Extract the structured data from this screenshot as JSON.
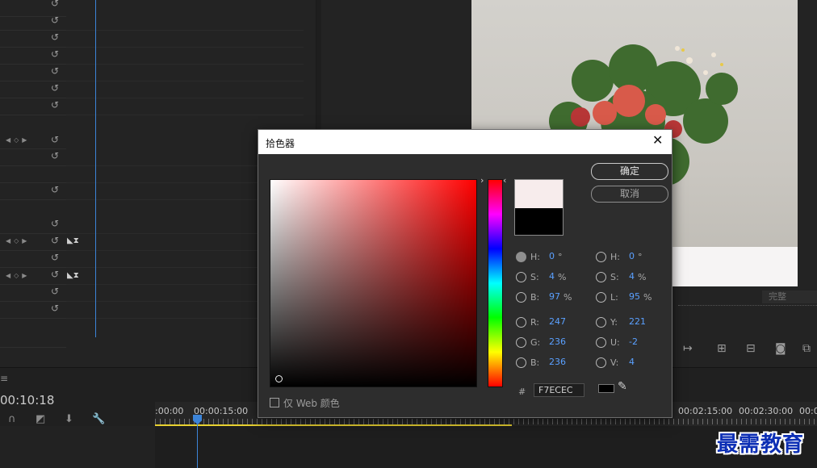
{
  "dialog": {
    "title": "拾色器",
    "ok_label": "确定",
    "cancel_label": "取消",
    "web_only_label": "仅 Web 颜色",
    "hex_label": "#",
    "hex_value": "F7ECEC",
    "new_color": "#F7ECEC",
    "old_color": "#000000",
    "fields_left": [
      {
        "label": "H:",
        "value": "0",
        "unit": "°",
        "selected": true
      },
      {
        "label": "S:",
        "value": "4",
        "unit": "%",
        "selected": false
      },
      {
        "label": "B:",
        "value": "97",
        "unit": "%",
        "selected": false
      },
      {
        "label": "R:",
        "value": "247",
        "unit": "",
        "selected": false
      },
      {
        "label": "G:",
        "value": "236",
        "unit": "",
        "selected": false
      },
      {
        "label": "B:",
        "value": "236",
        "unit": "",
        "selected": false
      }
    ],
    "fields_right": [
      {
        "label": "H:",
        "value": "0",
        "unit": "°",
        "selected": false
      },
      {
        "label": "S:",
        "value": "4",
        "unit": "%",
        "selected": false
      },
      {
        "label": "L:",
        "value": "95",
        "unit": "%",
        "selected": false
      },
      {
        "label": "Y:",
        "value": "221",
        "unit": "",
        "selected": false
      },
      {
        "label": "U:",
        "value": "-2",
        "unit": "",
        "selected": false
      },
      {
        "label": "V:",
        "value": "4",
        "unit": "",
        "selected": false
      }
    ]
  },
  "monitor": {
    "fit_label": "完整"
  },
  "timeline": {
    "timecode": "00:10:18",
    "ruler_labels": [
      ":00:00",
      "00:00:15:00",
      "00:02:15:00",
      "00:02:30:00",
      "00:0"
    ]
  },
  "watermark": "最需教育",
  "colors": {
    "accent": "#3C84D8",
    "value_text": "#5AA0FF",
    "work_area": "#E8D130"
  }
}
